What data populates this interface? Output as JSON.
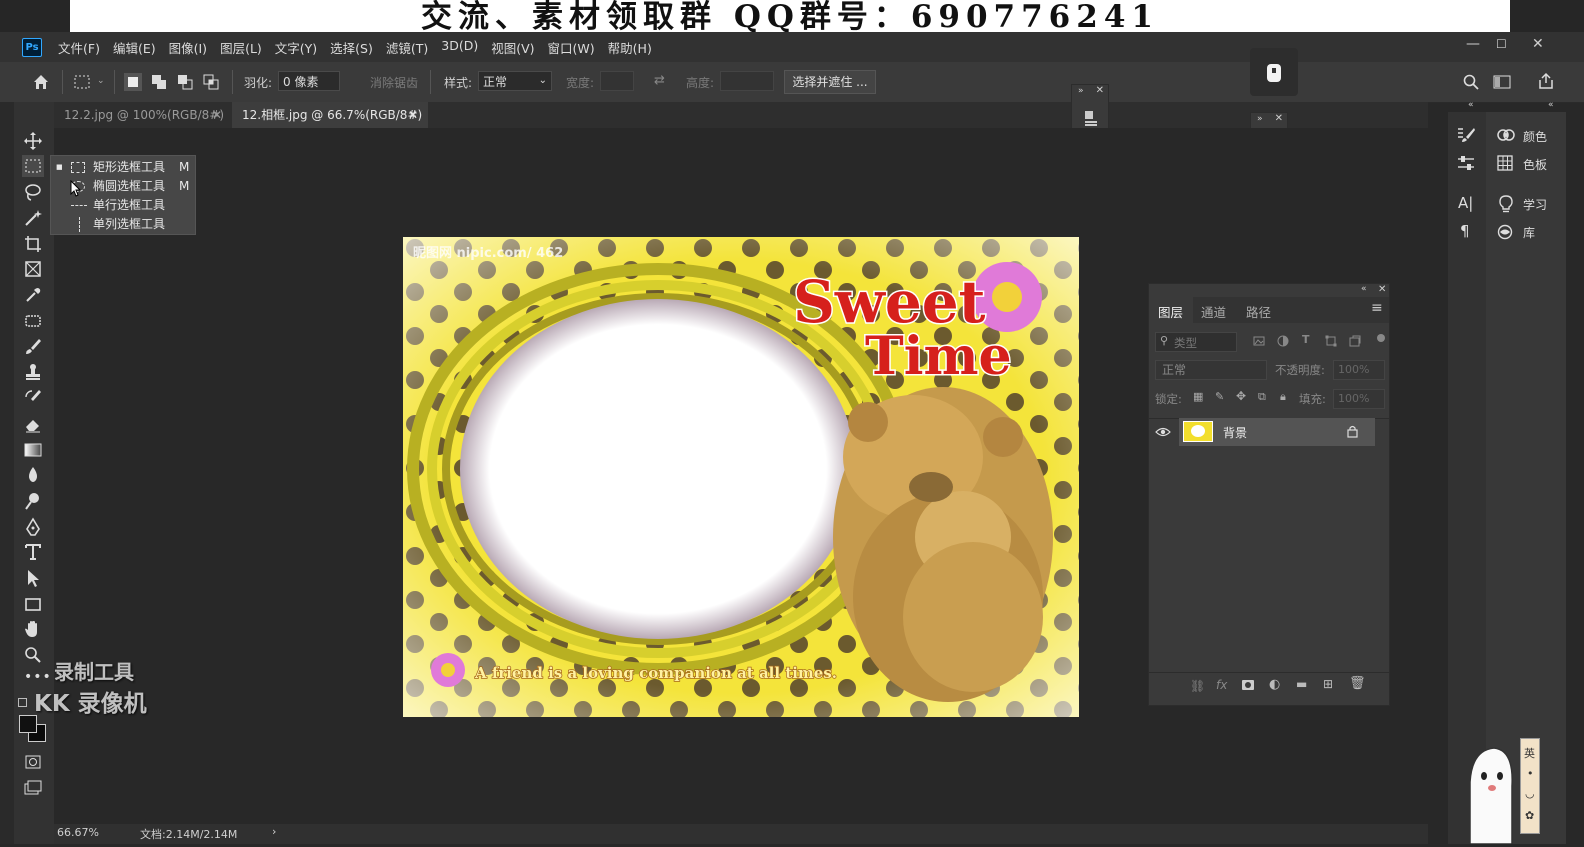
{
  "banner": {
    "text": "交流、素材领取群 QQ群号：690776241"
  },
  "app": {
    "logo": "Ps"
  },
  "menu": [
    "文件(F)",
    "编辑(E)",
    "图像(I)",
    "图层(L)",
    "文字(Y)",
    "选择(S)",
    "滤镜(T)",
    "3D(D)",
    "视图(V)",
    "窗口(W)",
    "帮助(H)"
  ],
  "options": {
    "feather_label": "羽化:",
    "feather_value": "0 像素",
    "antialias_label": "消除锯齿",
    "style_label": "样式:",
    "style_value": "正常",
    "width_label": "宽度:",
    "height_label": "高度:",
    "select_mask_label": "选择并遮住 ..."
  },
  "tabs": [
    {
      "label": "12.2.jpg @ 100%(RGB/8#)",
      "active": false
    },
    {
      "label": "12.相框.jpg @ 66.7%(RGB/8#)",
      "active": true
    }
  ],
  "flyout": {
    "items": [
      {
        "label": "矩形选框工具",
        "shortcut": "M"
      },
      {
        "label": "椭圆选框工具",
        "shortcut": "M"
      },
      {
        "label": "单行选框工具",
        "shortcut": ""
      },
      {
        "label": "单列选框工具",
        "shortcut": ""
      }
    ]
  },
  "image": {
    "watermark": "昵图网 nipic.com/ 462",
    "title1": "Sweet",
    "title2": "Time",
    "caption": "A friend is a loving companion at all times."
  },
  "overlay": {
    "line1": "录制工具",
    "line2": "KK 录像机"
  },
  "dock": {
    "color": "颜色",
    "swatches": "色板",
    "learn": "学习",
    "libraries": "库"
  },
  "layers": {
    "tabs": [
      "图层",
      "通道",
      "路径"
    ],
    "filter_placeholder": "类型",
    "blend_mode": "正常",
    "opacity_label": "不透明度:",
    "opacity_value": "100%",
    "lock_label": "锁定:",
    "fill_label": "填充:",
    "fill_value": "100%",
    "rows": [
      {
        "name": "背景"
      }
    ]
  },
  "status": {
    "zoom": "66.67%",
    "doc": "文档:2.14M/2.14M"
  },
  "ime": {
    "chars": [
      "英",
      "•",
      "◡",
      "✿"
    ]
  },
  "colors": {
    "accent": "#31a8ff",
    "frame_yellow": "#f2de2c"
  }
}
